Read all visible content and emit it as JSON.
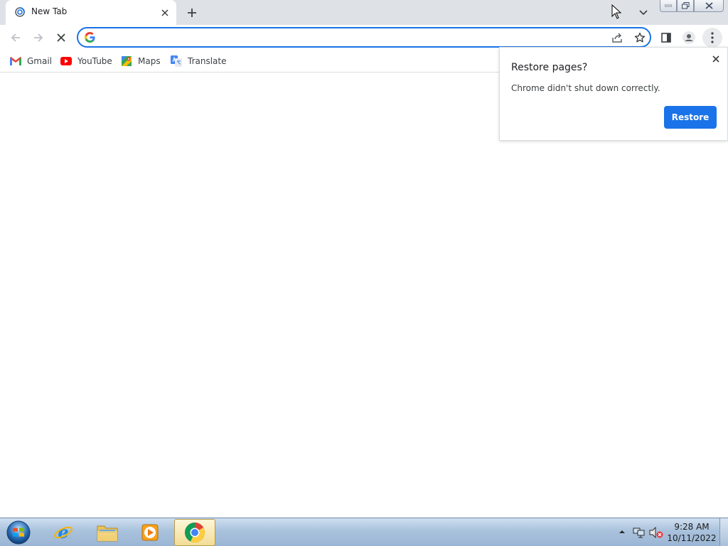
{
  "tab": {
    "title": "New Tab"
  },
  "omnibox": {
    "value": ""
  },
  "bookmarks": [
    {
      "label": "Gmail"
    },
    {
      "label": "YouTube"
    },
    {
      "label": "Maps"
    },
    {
      "label": "Translate"
    }
  ],
  "popup": {
    "title": "Restore pages?",
    "message": "Chrome didn't shut down correctly.",
    "button_label": "Restore"
  },
  "taskbar": {
    "time": "9:28 AM",
    "date": "10/11/2022",
    "apps": [
      "internet-explorer",
      "windows-explorer",
      "media-player",
      "chrome"
    ]
  },
  "colors": {
    "accent": "#1a73e8",
    "tabstrip": "#dee1e6"
  }
}
